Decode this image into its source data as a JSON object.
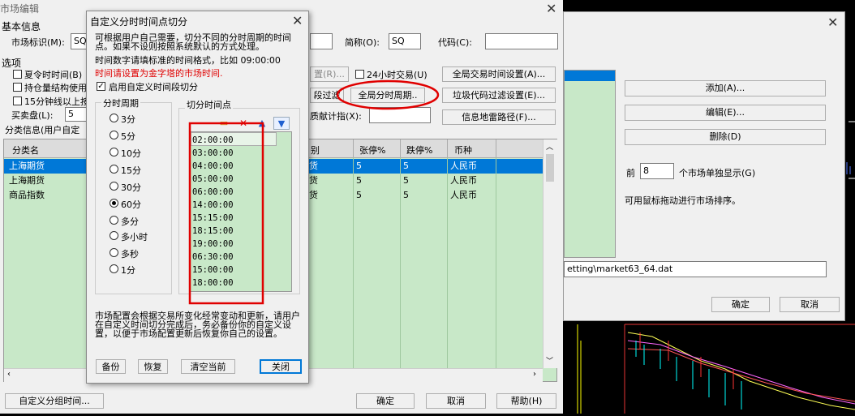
{
  "main": {
    "title": "市场编辑",
    "basic_info": "基本信息",
    "market_id_label": "市场标识(M):",
    "market_id_value": "SQ",
    "abbr_label": "简称(O):",
    "abbr_value": "SQ",
    "code_label": "代码(C):",
    "code_value": "",
    "options_label": "选项",
    "opt_summer": "夏令时时间(B)",
    "opt_position": "持仓量结构使用",
    "opt_15min": "15分钟线以上按",
    "buy_sell_label": "买卖盘(L):",
    "buy_sell_value": "5",
    "partial_r_btn": "置(R)...",
    "opt_24h": "24小时交易(U)",
    "global_trade_time_btn": "全局交易时间设置(A)...",
    "time_filter_btn": "段过滤",
    "global_period_btn": "全局分时周期..",
    "junk_filter_btn": "垃圾代码过滤设置(E)...",
    "contrib_label": "质献计指(X):",
    "contrib_value": "",
    "info_path_btn": "信息地雷路径(F)...",
    "category_label": "分类信息(用户自定",
    "grid": {
      "headers": [
        "分类名",
        "",
        "",
        "别",
        "张停%",
        "跌停%",
        "币种"
      ],
      "rows": [
        {
          "name": "上海期货",
          "c2": "",
          "c3": "货",
          "up": "5",
          "down": "5",
          "currency": "人民币",
          "selected": true
        },
        {
          "name": "上海期货",
          "c2": "",
          "c3": "货",
          "up": "5",
          "down": "5",
          "currency": "人民币",
          "selected": false
        },
        {
          "name": "商品指数",
          "c2": "",
          "c3": "货",
          "up": "5",
          "down": "5",
          "currency": "人民币",
          "selected": false
        }
      ]
    },
    "custom_group_btn": "自定义分组时间...",
    "ok_btn": "确定",
    "cancel_btn": "取消",
    "help_btn": "帮助(H)"
  },
  "right": {
    "add_btn": "添加(A)...",
    "edit_btn": "编辑(E)...",
    "delete_btn": "删除(D)",
    "front_label": "前",
    "front_value": "8",
    "front_suffix": "个市场单独显示(G)",
    "drag_hint": "可用鼠标拖动进行市场排序。",
    "path_value": "etting\\market63_64.dat",
    "ok_btn": "确定",
    "cancel_btn": "取消"
  },
  "dialog": {
    "title": "自定义分时时间点切分",
    "desc1": "可根据用户自己需要，切分不同的分时周期的时间点。如果不设则按照系统默认的方式处理。",
    "desc2": "时间数字请填标准的时间格式，比如 09:00:00",
    "desc_red": "时间请设置为金字塔的市场时间.",
    "enable_label": "启用自定义时间段切分",
    "period_group": "分时周期",
    "periods": [
      "3分",
      "5分",
      "10分",
      "15分",
      "30分",
      "60分",
      "多分",
      "多小时",
      "多秒",
      "1分"
    ],
    "selected_period": "60分",
    "cut_group": "切分时间点",
    "times": [
      "02:00:00",
      "03:00:00",
      "04:00:00",
      "05:00:00",
      "06:00:00",
      "14:00:00",
      "15:15:00",
      "18:15:00",
      "19:00:00",
      "06:30:00",
      "15:00:00",
      "18:00:00"
    ],
    "note": "市场配置会根据交易所变化经常变动和更新，请用户在自定义时间切分完成后，务必备份你的自定义设置，以便于市场配置更新后恢复你自己的设置。",
    "backup_btn": "备份",
    "restore_btn": "恢复",
    "clear_btn": "清空当前",
    "close_btn": "关闭"
  },
  "colors": {
    "grid_bg": "#c8e8c8",
    "selected_row": "#0078d7",
    "annotation_red": "#e00000"
  }
}
